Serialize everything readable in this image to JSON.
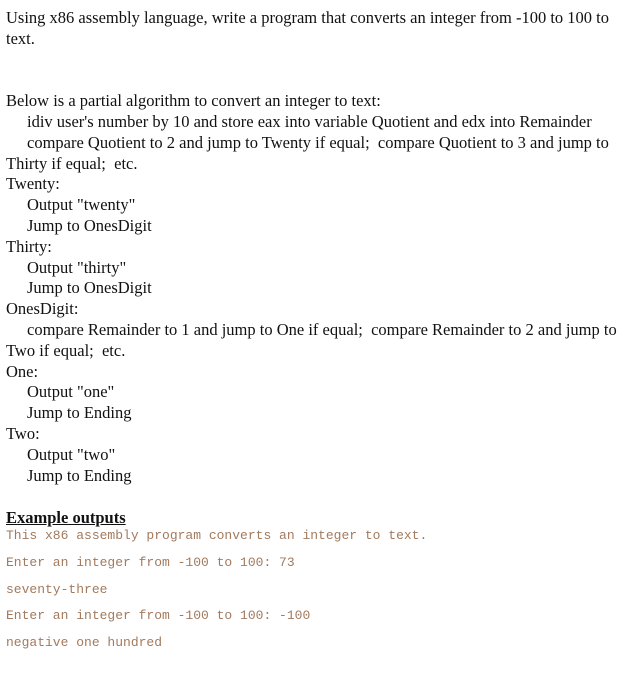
{
  "intro": {
    "line1": "Using x86 assembly language, write a program that converts an integer from -100 to 100 to",
    "line2": "text."
  },
  "algorithm": {
    "heading": "Below is a partial algorithm to convert an integer to text:",
    "step1": "idiv user's number by 10 and store eax into variable Quotient and edx into Remainder",
    "step2a": "compare Quotient to 2 and jump to Twenty if equal;  compare Quotient to 3 and jump to",
    "step2b": "Thirty if equal;  etc.",
    "twenty": {
      "label": "Twenty:",
      "output": "Output \"twenty\"",
      "jump": "Jump to OnesDigit"
    },
    "thirty": {
      "label": "Thirty:",
      "output": "Output \"thirty\"",
      "jump": "Jump to OnesDigit"
    },
    "ones_digit": {
      "label": "OnesDigit:",
      "step_a": "compare Remainder to 1 and jump to One if equal;  compare Remainder to 2 and jump to",
      "step_b": "Two if equal;  etc."
    },
    "one": {
      "label": "One:",
      "output": "Output \"one\"",
      "jump": "Jump to Ending"
    },
    "two": {
      "label": "Two:",
      "output": "Output \"two\"",
      "jump": "Jump to Ending"
    }
  },
  "examples": {
    "heading": "Example outputs",
    "text_color": "#a27a5e",
    "lines": [
      "This x86 assembly program converts an integer to text.",
      "Enter an integer from -100 to 100: 73",
      "seventy-three",
      "Enter an integer from -100 to 100: -100",
      "negative one hundred"
    ]
  }
}
